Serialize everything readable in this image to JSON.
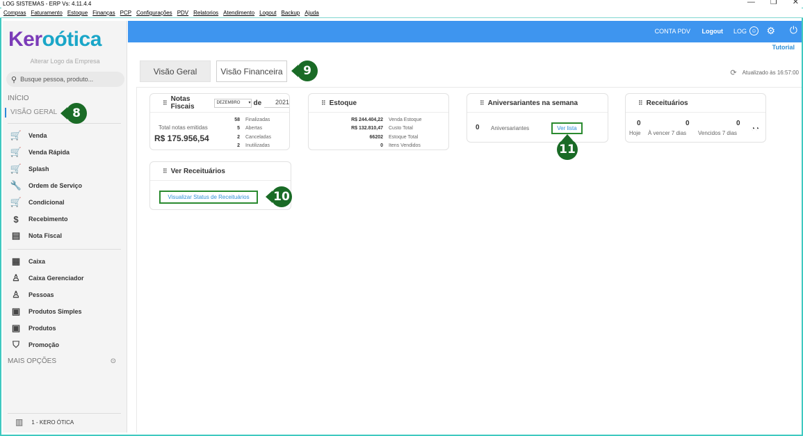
{
  "window": {
    "title": "LOG SISTEMAS - ERP Vs: 4.11.4.4",
    "controls": [
      "—",
      "❐",
      "✕"
    ]
  },
  "menu": [
    "Compras",
    "Faturamento",
    "Estoque",
    "Finanças",
    "PCP",
    "Configurações",
    "PDV",
    "Relatorios",
    "Atendimento",
    "Logout",
    "Backup",
    "Ajuda"
  ],
  "sidebar": {
    "logo": {
      "k": "Ker",
      "rest": "oótica"
    },
    "alter_logo": "Alterar Logo da Empresa",
    "search_placeholder": "Busque pessoa, produto...",
    "inicio": "INÍCIO",
    "visao_geral": "VISÃO GERAL",
    "group1": [
      {
        "label": "Venda",
        "icon": "cart-icon"
      },
      {
        "label": "Venda Rápida",
        "icon": "cart-fast-icon"
      },
      {
        "label": "Splash",
        "icon": "cart-splash-icon"
      },
      {
        "label": "Ordem de Serviço",
        "icon": "wrench-icon"
      },
      {
        "label": "Condicional",
        "icon": "cart-conditional-icon"
      },
      {
        "label": "Recebimento",
        "icon": "hand-money-icon"
      },
      {
        "label": "Nota Fiscal",
        "icon": "nfe-icon"
      }
    ],
    "group2": [
      {
        "label": "Caixa",
        "icon": "cash-register-icon"
      },
      {
        "label": "Caixa Gerenciador",
        "icon": "user-manager-icon"
      },
      {
        "label": "Pessoas",
        "icon": "people-icon"
      },
      {
        "label": "Produtos Simples",
        "icon": "box-icon"
      },
      {
        "label": "Produtos",
        "icon": "box-icon"
      },
      {
        "label": "Promoção",
        "icon": "tag-icon"
      }
    ],
    "mais_opcoes": "MAIS OPÇÕES",
    "company": "1 - KERO ÓTICA"
  },
  "topbar": {
    "conta_pdv": "CONTA PDV",
    "logout": "Logout",
    "user": "LOG",
    "tutorial": "Tutorial"
  },
  "tabs": {
    "geral": "Visão Geral",
    "financeira": "Visão Financeira"
  },
  "updated": "Atualizado às 16:57:00",
  "cards": {
    "notas": {
      "title": "Notas Fiscais",
      "month": "DEZEMBRO",
      "de": "de",
      "year": "2021",
      "total_label": "Total notas emitidas",
      "total_value": "R$ 175.956,54",
      "rows": [
        {
          "v": "58",
          "l": "Finalizadas"
        },
        {
          "v": "5",
          "l": "Abertas"
        },
        {
          "v": "2",
          "l": "Canceladas"
        },
        {
          "v": "2",
          "l": "Inutilizadas"
        }
      ]
    },
    "estoque": {
      "title": "Estoque",
      "rows": [
        {
          "v": "R$ 244.404,22",
          "l": "Venda Estoque"
        },
        {
          "v": "R$ 132.810,47",
          "l": "Custo Total"
        },
        {
          "v": "66202",
          "l": "Estoque Total"
        },
        {
          "v": "0",
          "l": "Itens Vendidos"
        }
      ]
    },
    "aniversariantes": {
      "title": "Aniversariantes na semana",
      "count": "0",
      "label": "Aniversariantes",
      "link": "Ver lista"
    },
    "receituarios": {
      "title": "Receituários",
      "cols": [
        {
          "v": "0",
          "l": "Hoje"
        },
        {
          "v": "0",
          "l": "À vencer 7 dias"
        },
        {
          "v": "0",
          "l": "Vencidos 7 dias"
        }
      ]
    },
    "ver_receituarios": {
      "title": "Ver Receituários",
      "link": "Visualizar Status de Receituários"
    }
  },
  "callouts": [
    "8",
    "9",
    "10",
    "11"
  ],
  "colors": {
    "topbar": "#3e95ef",
    "callout": "#1a6b26",
    "link": "#2f8fd6",
    "accent_border": "#3fc9c0"
  }
}
